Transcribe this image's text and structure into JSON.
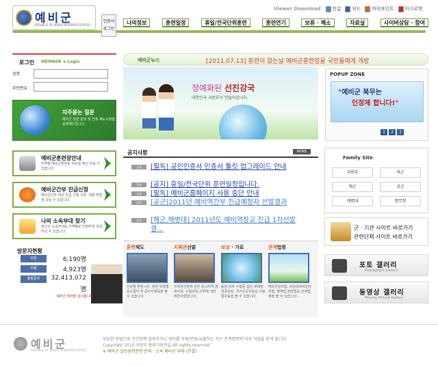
{
  "header": {
    "logo_title": "예비군",
    "logo_sub": "REPUBLIC OF KOREA RESERVED FORCES",
    "viewer_label": "Viewer Download",
    "viewers": [
      "한글",
      "워드",
      "파워포인트",
      "아크로뱃"
    ],
    "nav": [
      "나의정보",
      "훈련일정",
      "휴일/전국단위훈련",
      "훈련연기",
      "보류 · 해소",
      "자료실",
      "사이버상담 · 참여"
    ]
  },
  "login": {
    "title": "로그인",
    "subtitle": "MEMBER`s Login",
    "id_label": "성명",
    "pw_label": "주민번호",
    "button": "인증서\n로그인"
  },
  "faq": {
    "title": "자주묻는 질문",
    "desc": "예비군 관련 질의 및 간혹 제도사항을 설명해드립니다."
  },
  "quick_links": [
    {
      "title": "예비군훈련장안내",
      "desc": "지역별 예비군훈련장 위치를 확인 하실 수 있습니다."
    },
    {
      "title": "예비군간부 진급신청",
      "desc": "예비군간부 대상 진급 신청 서류, 제출 방법을 보실 수 있습니다."
    },
    {
      "title": "나의 소속부대 찾기",
      "desc": "본인의 소속부대를 지역별로 간편하게 조회 하실 수 있습니다."
    }
  ],
  "visitors": {
    "title": "방문자현황",
    "today_label": "오늘",
    "today": "6,190명",
    "yesterday_label": "어제",
    "yesterday": "4,923명",
    "total_label": "총방문자",
    "total": "32,413,072",
    "total_suffix": "명",
    "quote": "예비군 여러분 감사합니다"
  },
  "news": {
    "label": "예비군뉴스",
    "headline": "[2011.07.13]  훈련이 없는날 예비군훈련장을 국민들에게 개방"
  },
  "main_visual": {
    "slogan_prefix": "정예화된",
    "slogan_main": "선진강국",
    "slogan_sub": "대한민국 국방부가 만들어갑니다."
  },
  "popup": {
    "title": "POPUP ZONE",
    "line1": "\"예비군 복무는",
    "line2": "인정제 합니다!\"",
    "pages": [
      "1",
      "2",
      "3"
    ]
  },
  "notices": {
    "title": "공지사항",
    "more": "MORE",
    "items": [
      {
        "tag": "공지",
        "text": "[필독] 공인인증서 인증서 툴킷 업그레이드 안내"
      },
      {
        "tag": "공지",
        "text": "[공지] 휴일/전국단위 훈련일정입니다."
      },
      {
        "tag": "공지",
        "text": "[필독] 예비군홈페이지 사용 중단 안내"
      },
      {
        "tag": "공지",
        "text": "[공군]2011년 예비역간부 진급예정자 선발결과"
      },
      {
        "tag": "공지",
        "text": "[해군,해병대] 2011년도 예비역장교 진급 1차선발결..."
      }
    ]
  },
  "columns": [
    {
      "title_hl": "훈련",
      "title_rest": "제도",
      "desc": "신분별 훈련시간, 훈련 유형별 응소절차 및 준수사항등을 볼 수 있습니다."
    },
    {
      "title_hl": "지휘관",
      "title_rest": "선발",
      "desc": "지휘관선발에 관한 응시자격,경력사유, 시험과목,서류에 대한 제반사항입니다."
    },
    {
      "title_hl": "보상",
      "title_rest": " · 가료",
      "desc": "동원,임무 수행중 입은 재해발생경보상, 국가유공자보상,가료 절차등을 볼 수 있습니다."
    },
    {
      "title_hl": "관계",
      "title_rest": "법령",
      "desc": "예비군설치법, 비상대비자원관리법, 병역법,징발법등 관계법령을 볼 수 있습니다."
    }
  ],
  "family": {
    "title": "Family Site",
    "sites": [
      "국방부",
      "육군",
      "해군",
      "공군",
      "해병대",
      "병무청"
    ]
  },
  "site_links": {
    "select1": "군 · 기관 사이트 바로가기",
    "select2": "관련단체 사이트 바로가기"
  },
  "gallery": [
    {
      "title": "포토 갤러리",
      "sub": "Photograph Gallery"
    },
    {
      "title": "동영상 갤러리",
      "sub": "Moving Picture Gallery"
    }
  ],
  "footer": {
    "logo_title": "예비군",
    "logo_sub": "REPUBLIC OF KOREA RESERVED FORCES",
    "line1": "부당한 방법으로 전산망에 접속하거나 정보를 삭제/변경/유출하는 자는 관계법령에 따라 처벌을 받게 됩니다.",
    "line2": "Copyright 2010 국방부 동원기획관실 All rights reserved",
    "line3": "※ 예비군 일반훈련관련 문의 : 소속 예비군 부대 (연결)"
  }
}
